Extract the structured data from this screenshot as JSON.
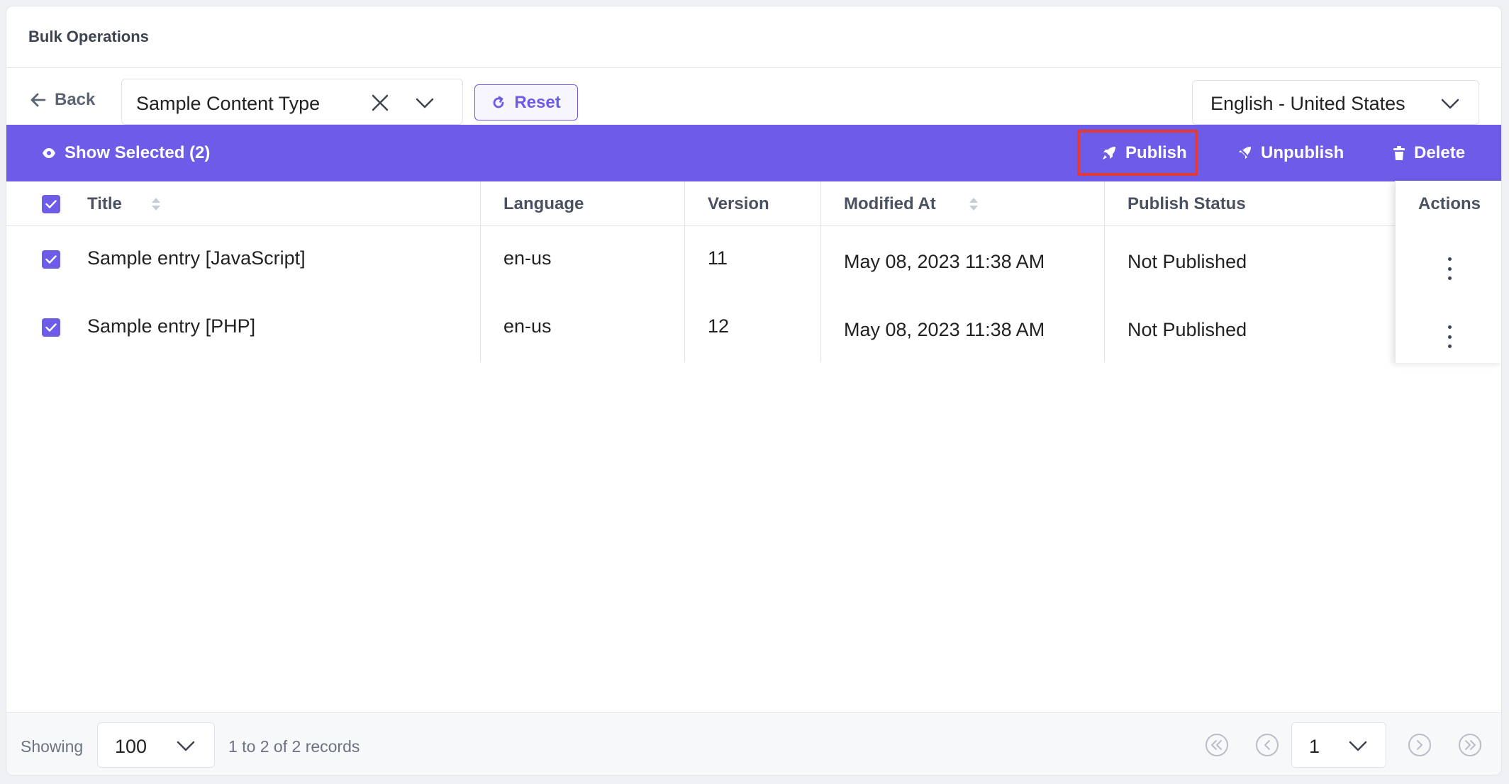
{
  "header": {
    "title": "Bulk Operations"
  },
  "toolbar": {
    "back_label": "Back",
    "content_type_value": "Sample Content Type",
    "reset_label": "Reset",
    "locale_value": "English - United States"
  },
  "bulkbar": {
    "show_selected_label": "Show Selected (2)",
    "publish_label": "Publish",
    "unpublish_label": "Unpublish",
    "delete_label": "Delete",
    "highlighted_action": "Publish",
    "highlight_color": "#e53935"
  },
  "table": {
    "columns": [
      "Title",
      "Language",
      "Version",
      "Modified At",
      "Publish Status",
      "Actions"
    ],
    "rows": [
      {
        "title": "Sample entry [JavaScript]",
        "language": "en-us",
        "version": "11",
        "modified_at": "May 08, 2023 11:38 AM",
        "status": "Not Published",
        "checked": true
      },
      {
        "title": "Sample entry [PHP]",
        "language": "en-us",
        "version": "12",
        "modified_at": "May 08, 2023 11:38 AM",
        "status": "Not Published",
        "checked": true
      }
    ]
  },
  "footer": {
    "showing_label": "Showing",
    "page_size": "100",
    "records_text": "1 to 2 of 2 records",
    "page_number": "1"
  },
  "colors": {
    "accent": "#6c5ce7"
  }
}
